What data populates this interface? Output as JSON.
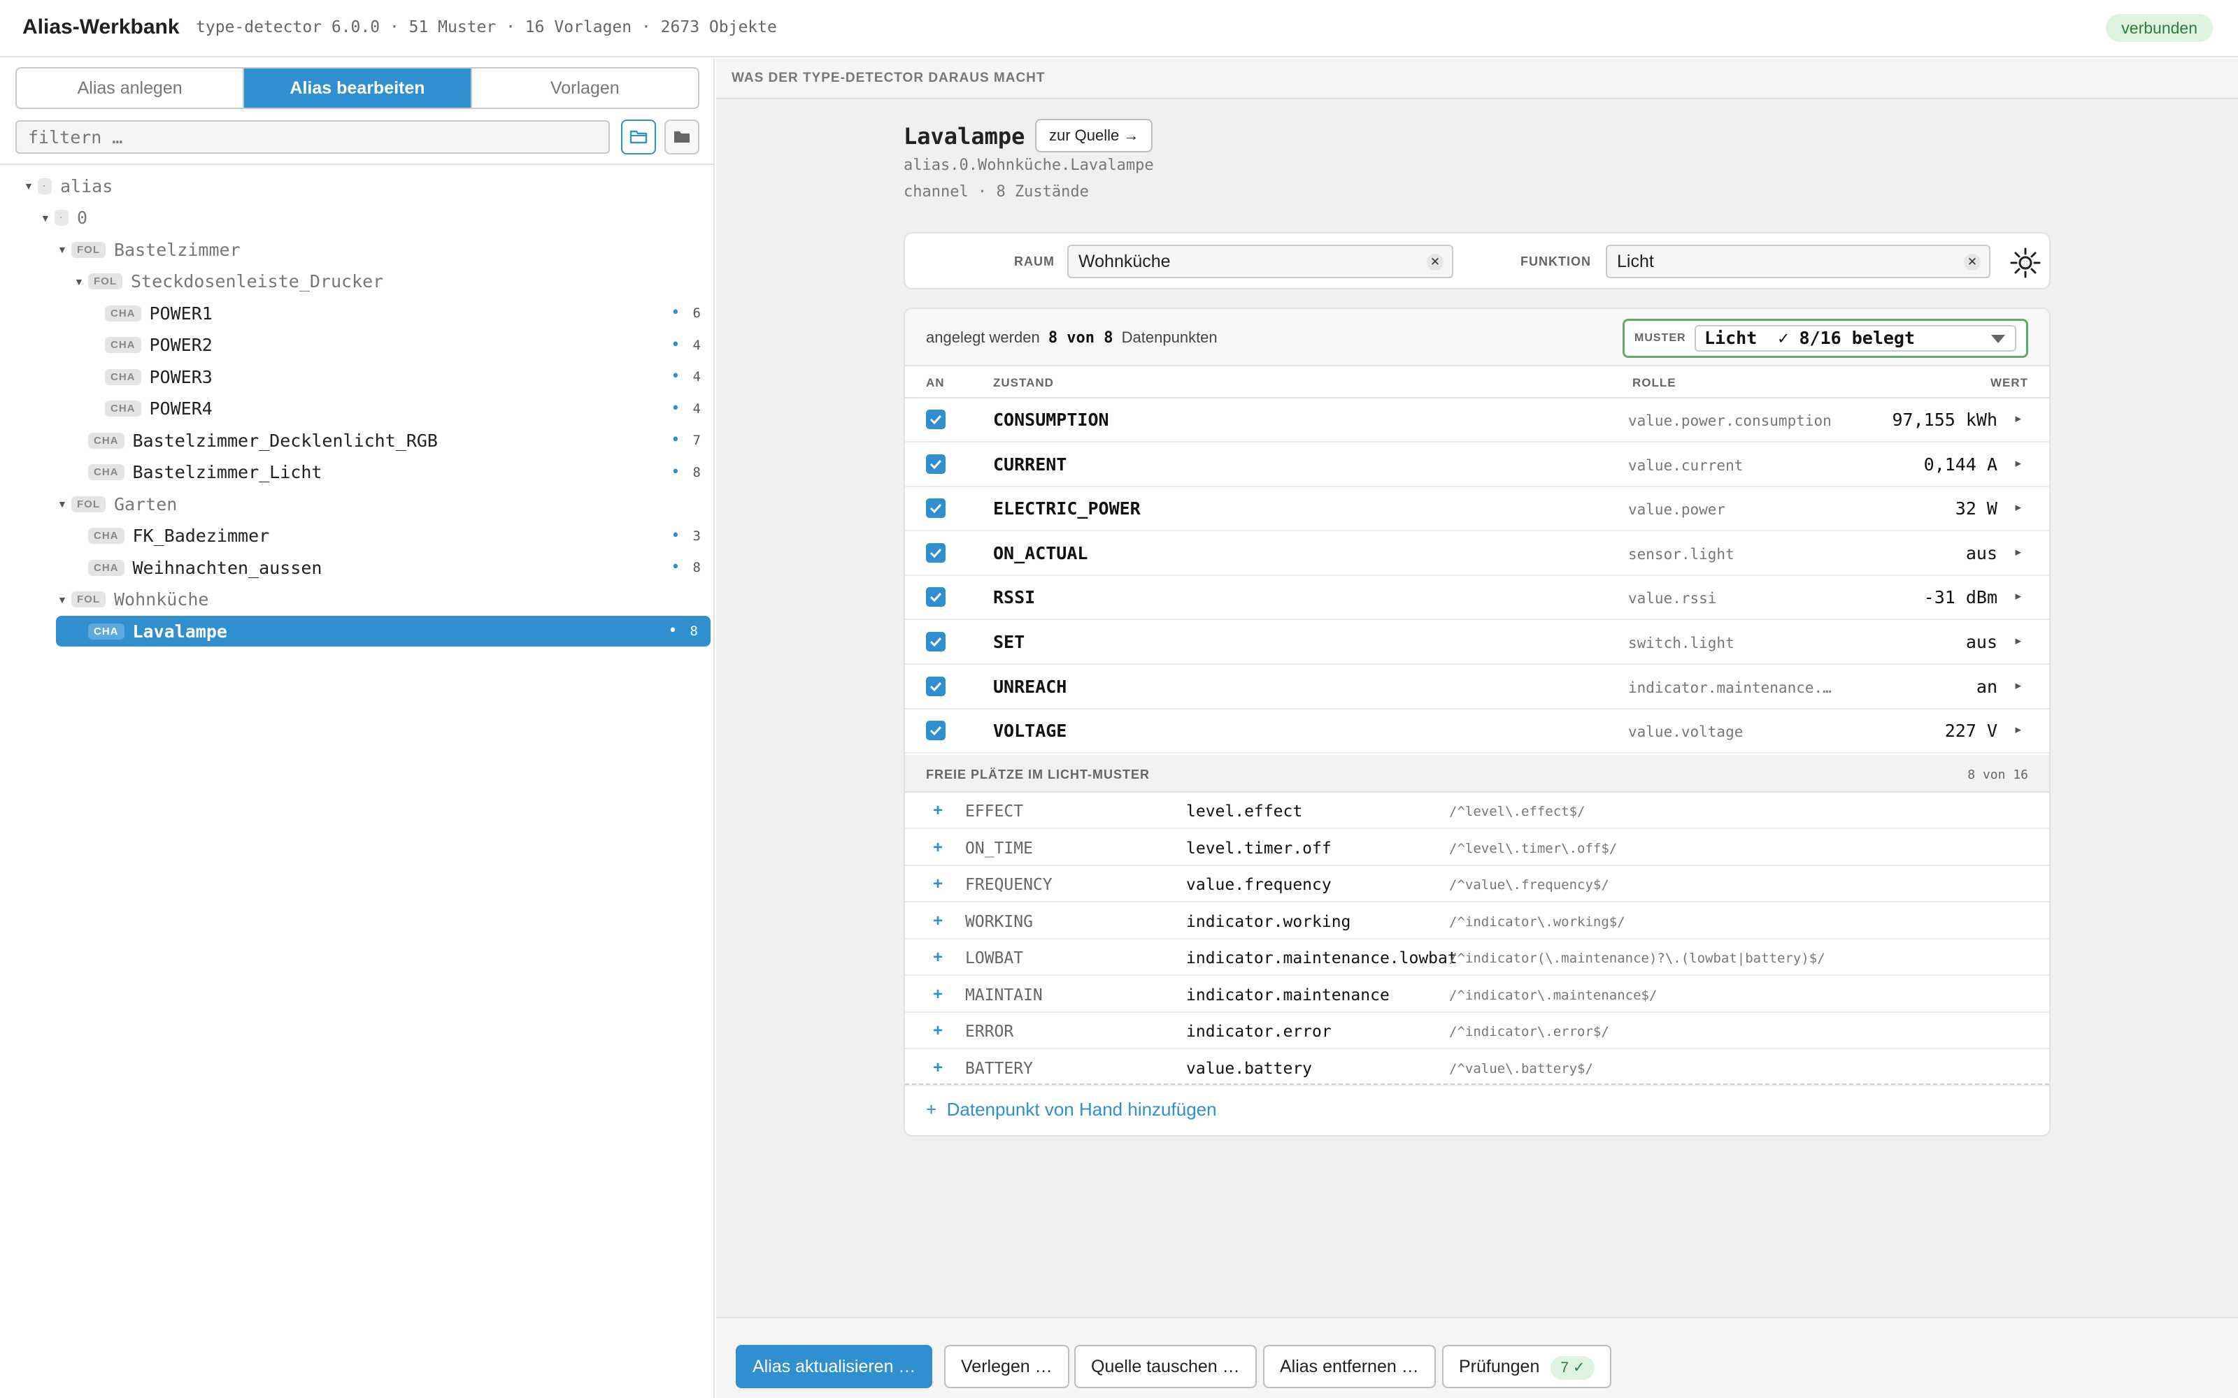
{
  "app": {
    "title": "Alias-Werkbank",
    "meta": "type-detector 6.0.0 · 51 Muster · 16 Vorlagen · 2673 Objekte",
    "status": "verbunden"
  },
  "left": {
    "tabs": [
      {
        "label": "Alias anlegen",
        "active": false
      },
      {
        "label": "Alias bearbeiten",
        "active": true
      },
      {
        "label": "Vorlagen",
        "active": false
      }
    ],
    "filter_placeholder": "filtern …",
    "tree": [
      {
        "kind": "root",
        "chip": "·",
        "label": "alias",
        "caret": true,
        "count": null,
        "selected": false
      },
      {
        "kind": "root",
        "chip": "·",
        "label": "0",
        "caret": true,
        "count": null,
        "selected": false
      },
      {
        "kind": "FOL",
        "chip": "FOL",
        "label": "Bastelzimmer",
        "caret": true,
        "count": null,
        "selected": false
      },
      {
        "kind": "FOL",
        "chip": "FOL",
        "label": "Steckdosenleiste_Drucker",
        "caret": true,
        "count": null,
        "selected": false
      },
      {
        "kind": "CHA",
        "chip": "CHA",
        "label": "POWER1",
        "caret": false,
        "count": "6",
        "selected": false
      },
      {
        "kind": "CHA",
        "chip": "CHA",
        "label": "POWER2",
        "caret": false,
        "count": "4",
        "selected": false
      },
      {
        "kind": "CHA",
        "chip": "CHA",
        "label": "POWER3",
        "caret": false,
        "count": "4",
        "selected": false
      },
      {
        "kind": "CHA",
        "chip": "CHA",
        "label": "POWER4",
        "caret": false,
        "count": "4",
        "selected": false
      },
      {
        "kind": "CHA",
        "chip": "CHA",
        "label": "Bastelzimmer_Decklenlicht_RGB",
        "caret": false,
        "count": "7",
        "selected": false
      },
      {
        "kind": "CHA",
        "chip": "CHA",
        "label": "Bastelzimmer_Licht",
        "caret": false,
        "count": "8",
        "selected": false
      },
      {
        "kind": "FOL",
        "chip": "FOL",
        "label": "Garten",
        "caret": true,
        "count": null,
        "selected": false
      },
      {
        "kind": "CHA",
        "chip": "CHA",
        "label": "FK_Badezimmer",
        "caret": false,
        "count": "3",
        "selected": false
      },
      {
        "kind": "CHA",
        "chip": "CHA",
        "label": "Weihnachten_aussen",
        "caret": false,
        "count": "8",
        "selected": false
      },
      {
        "kind": "FOL",
        "chip": "FOL",
        "label": "Wohnküche",
        "caret": true,
        "count": null,
        "selected": false
      },
      {
        "kind": "CHA",
        "chip": "CHA",
        "label": "Lavalampe",
        "caret": false,
        "count": "8",
        "selected": true
      }
    ]
  },
  "right": {
    "section_label": "WAS DER TYPE-DETECTOR DARAUS MACHT",
    "object": {
      "name": "Lavalampe",
      "source_button": "zur Quelle →",
      "path": "alias.0.Wohnküche.Lavalampe",
      "type_line": "channel · 8 Zustände"
    },
    "assign": {
      "room_label": "RAUM",
      "room_value": "Wohnküche",
      "function_label": "FUNKTION",
      "function_value": "Licht",
      "clear_glyph": "✕"
    },
    "datapoints": {
      "summary_pre": "angelegt werden",
      "summary_count": "8 von 8",
      "summary_post": "Datenpunkten",
      "muster_label": "MUSTER",
      "muster_value": "Licht  ✓ 8/16 belegt",
      "columns": {
        "on": "AN",
        "state": "ZUSTAND",
        "role": "ROLLE",
        "value": "WERT"
      },
      "rows": [
        {
          "name": "CONSUMPTION",
          "role": "value.power.consumption",
          "value": "97,155 kWh"
        },
        {
          "name": "CURRENT",
          "role": "value.current",
          "value": "0,144 A"
        },
        {
          "name": "ELECTRIC_POWER",
          "role": "value.power",
          "value": "32 W"
        },
        {
          "name": "ON_ACTUAL",
          "role": "sensor.light",
          "value": "aus"
        },
        {
          "name": "RSSI",
          "role": "value.rssi",
          "value": "-31 dBm"
        },
        {
          "name": "SET",
          "role": "switch.light",
          "value": "aus"
        },
        {
          "name": "UNREACH",
          "role": "indicator.maintenance.u…",
          "value": "an"
        },
        {
          "name": "VOLTAGE",
          "role": "value.voltage",
          "value": "227 V"
        }
      ],
      "free_title": "FREIE PLÄTZE IM LICHT-MUSTER",
      "free_count": "8 von 16",
      "free": [
        {
          "name": "EFFECT",
          "role": "level.effect",
          "regex": "/^level\\.effect$/"
        },
        {
          "name": "ON_TIME",
          "role": "level.timer.off",
          "regex": "/^level\\.timer\\.off$/"
        },
        {
          "name": "FREQUENCY",
          "role": "value.frequency",
          "regex": "/^value\\.frequency$/"
        },
        {
          "name": "WORKING",
          "role": "indicator.working",
          "regex": "/^indicator\\.working$/"
        },
        {
          "name": "LOWBAT",
          "role": "indicator.maintenance.lowbat",
          "regex": "/^indicator(\\.maintenance)?\\.(lowbat|battery)$/"
        },
        {
          "name": "MAINTAIN",
          "role": "indicator.maintenance",
          "regex": "/^indicator\\.maintenance$/"
        },
        {
          "name": "ERROR",
          "role": "indicator.error",
          "regex": "/^indicator\\.error$/"
        },
        {
          "name": "BATTERY",
          "role": "value.battery",
          "regex": "/^value\\.battery$/"
        }
      ],
      "add_manual": "+  Datenpunkt von Hand hinzufügen"
    },
    "footer": {
      "update": "Alias aktualisieren …",
      "move": "Verlegen …",
      "swap": "Quelle tauschen …",
      "remove": "Alias entfernen …",
      "checks": "Prüfungen",
      "checks_badge": "7 ✓"
    }
  },
  "colors": {
    "accent": "#2f8fcf",
    "ok_bg": "#dff3e3",
    "ok_fg": "#2e7d3a",
    "muster_border": "#5fae67"
  }
}
